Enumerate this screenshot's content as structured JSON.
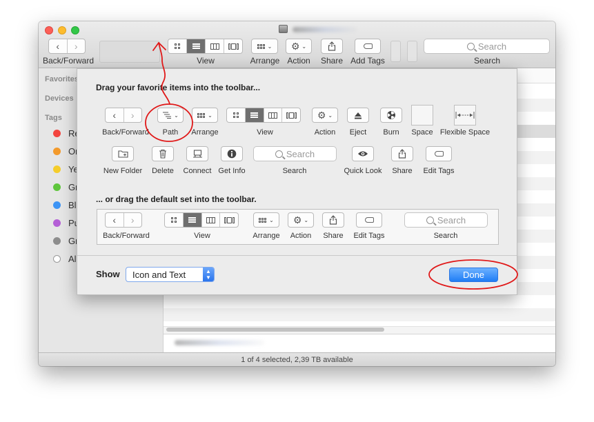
{
  "window": {
    "status_bar": "1 of 4 selected, 2,39 TB available",
    "toolbar": {
      "back_forward_label": "Back/Forward",
      "view_label": "View",
      "arrange_label": "Arrange",
      "action_label": "Action",
      "share_label": "Share",
      "add_tags_label": "Add Tags",
      "search_placeholder": "Search",
      "search_label": "Search"
    },
    "sidebar": {
      "favorites": "Favorites",
      "devices": "Devices",
      "tags_header": "Tags",
      "tags": [
        {
          "label": "Re",
          "color": "#f3453f"
        },
        {
          "label": "Or",
          "color": "#f39a2c"
        },
        {
          "label": "Ye",
          "color": "#f5cd2b"
        },
        {
          "label": "Gr",
          "color": "#5fc63d"
        },
        {
          "label": "Bl",
          "color": "#3d94f5"
        },
        {
          "label": "Pu",
          "color": "#b45fd6"
        },
        {
          "label": "Gr",
          "color": "#8d8d8d"
        },
        {
          "label": "Al",
          "color": "#ffffff"
        }
      ]
    }
  },
  "sheet": {
    "heading_favorites": "Drag your favorite items into the toolbar...",
    "heading_default": "... or drag the default set into the toolbar.",
    "items_row1": {
      "back_forward": "Back/Forward",
      "path": "Path",
      "arrange": "Arrange",
      "view": "View",
      "action": "Action",
      "eject": "Eject",
      "burn": "Burn",
      "space": "Space",
      "flexible_space": "Flexible Space"
    },
    "items_row2": {
      "new_folder": "New Folder",
      "delete": "Delete",
      "connect": "Connect",
      "get_info": "Get Info",
      "search_placeholder": "Search",
      "search": "Search",
      "quick_look": "Quick Look",
      "share": "Share",
      "edit_tags": "Edit Tags"
    },
    "default_set": {
      "back_forward": "Back/Forward",
      "view": "View",
      "arrange": "Arrange",
      "action": "Action",
      "share": "Share",
      "edit_tags": "Edit Tags",
      "search_placeholder": "Search",
      "search": "Search"
    },
    "show_label": "Show",
    "show_value": "Icon and Text",
    "done_label": "Done"
  },
  "colors": {
    "annotation_red": "#e01818",
    "accent_blue": "#2a74ec"
  }
}
